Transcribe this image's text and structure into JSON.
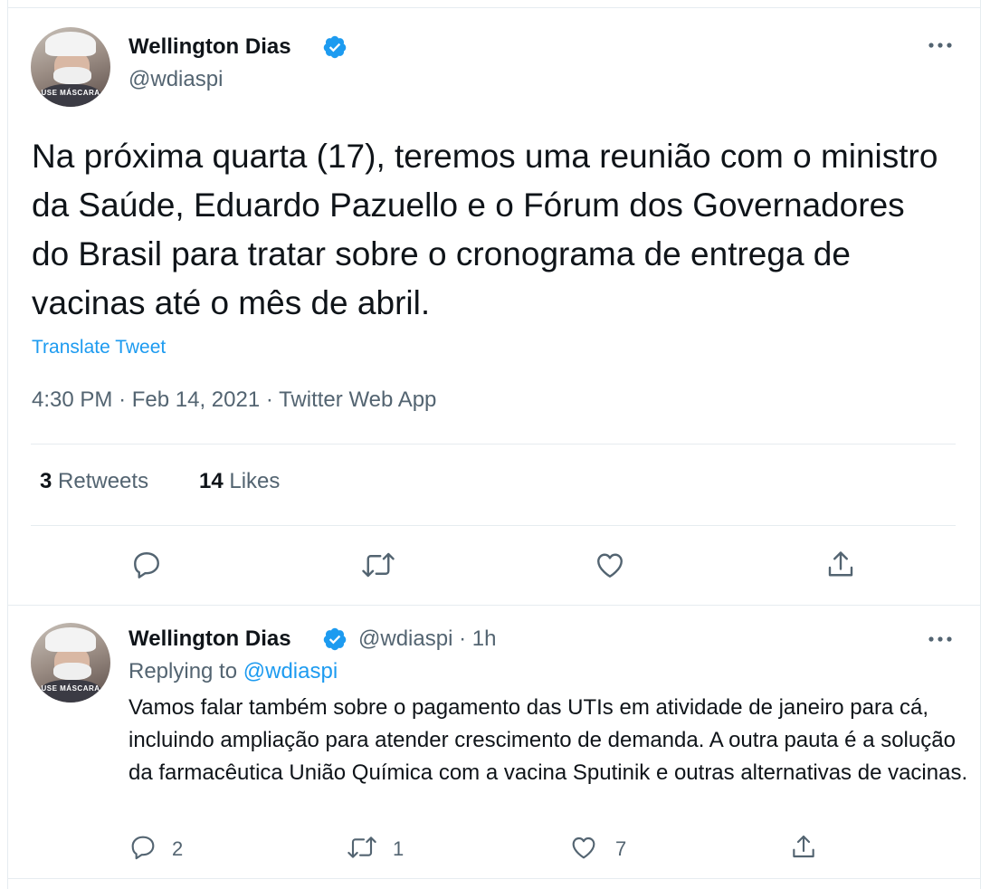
{
  "tweet": {
    "author_name": "Wellington Dias",
    "author_handle": "@wdiaspi",
    "avatar_text": "USE MÁSCARA",
    "text": "Na próxima quarta (17), teremos uma reunião com o ministro da Saúde, Eduardo Pazuello e o Fórum dos Governadores do Brasil para tratar sobre o cronograma de entrega de vacinas até o mês de abril.",
    "translate_label": "Translate Tweet",
    "time": "4:30 PM",
    "date": "Feb 14, 2021",
    "source": "Twitter Web App",
    "retweets_count": "3",
    "retweets_label": "Retweets",
    "likes_count": "14",
    "likes_label": "Likes"
  },
  "reply": {
    "author_name": "Wellington Dias",
    "author_handle": "@wdiaspi",
    "time_ago": "1h",
    "replying_to_label": "Replying to",
    "replying_to_handle": "@wdiaspi",
    "avatar_text": "USE MÁSCARA",
    "text": "Vamos falar também sobre o pagamento das UTIs em atividade de janeiro para cá, incluindo ampliação para atender crescimento de demanda. A outra pauta é a solução da farmacêutica União Química com a vacina Sputinik e outras alternativas de vacinas.",
    "reply_count": "2",
    "retweet_count": "1",
    "like_count": "7"
  },
  "separator_dot": "·",
  "icons": [
    "verified-badge-icon",
    "more-options-icon",
    "reply-icon",
    "retweet-icon",
    "like-icon",
    "share-icon"
  ],
  "colors": {
    "accent": "#1d9bf0",
    "text": "#0f1419",
    "secondary": "#536471",
    "border": "#e6ecf0"
  }
}
